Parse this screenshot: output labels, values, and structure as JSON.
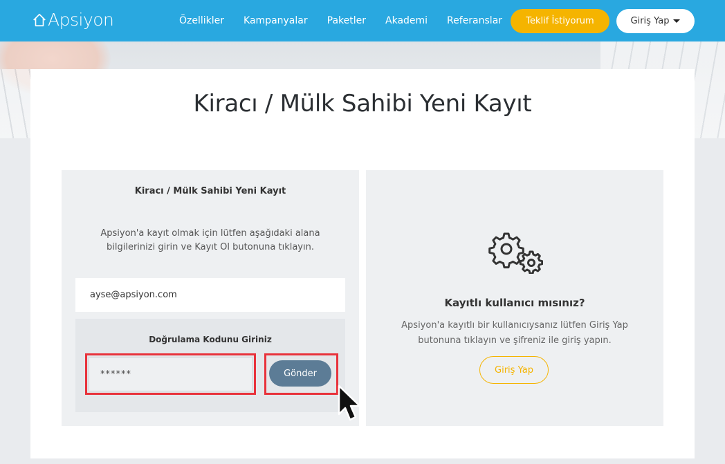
{
  "nav": {
    "logo": "Apsiyon",
    "items": [
      "Özellikler",
      "Kampanyalar",
      "Paketler",
      "Akademi",
      "Referanslar"
    ],
    "offer_button": "Teklif İstiyorum",
    "login_button": "Giriş Yap"
  },
  "page": {
    "title": "Kiracı / Mülk Sahibi Yeni Kayıt"
  },
  "register": {
    "title": "Kiracı / Mülk Sahibi Yeni Kayıt",
    "description": "Apsiyon'a kayıt olmak için lütfen aşağıdaki alana bilgilerinizi girin ve Kayıt Ol butonuna tıklayın.",
    "email_value": "ayse@apsiyon.com",
    "verify_title": "Doğrulama Kodunu Giriniz",
    "code_value": "******",
    "send_button": "Gönder"
  },
  "existing": {
    "title": "Kayıtlı kullanıcı mısınız?",
    "description": "Apsiyon'a kayıtlı bir kullanıcıysanız lütfen Giriş Yap butonuna tıklayın ve şifreniz ile giriş yapın.",
    "login_button": "Giriş Yap"
  },
  "colors": {
    "nav": "#29a8e0",
    "accent": "#f5b400",
    "send_button": "#5c7c96",
    "highlight": "#e8323b"
  },
  "icons": [
    "home-icon",
    "caret-down-icon",
    "gears-icon",
    "mouse-cursor-icon"
  ]
}
